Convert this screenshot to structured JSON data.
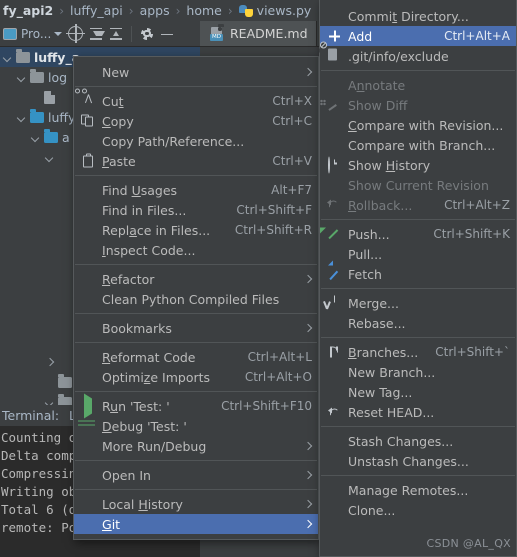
{
  "breadcrumb": {
    "items": [
      {
        "label": "fy_api2",
        "bold": true,
        "icon": ""
      },
      {
        "label": "luffy_api",
        "bold": false,
        "icon": ""
      },
      {
        "label": "apps",
        "bold": false,
        "icon": ""
      },
      {
        "label": "home",
        "bold": false,
        "icon": ""
      },
      {
        "label": "views.py",
        "bold": false,
        "icon": "python-file-icon"
      }
    ],
    "separator": "›"
  },
  "project_toolbar": {
    "project_label": "Pro...",
    "icons": [
      "project-icon",
      "locate-target-icon",
      "expand-all-icon",
      "collapse-all-icon",
      "settings-gear-icon",
      "minimize-icon"
    ]
  },
  "editor_tabs": {
    "tabs": [
      {
        "label": "README.md",
        "icon": "markdown-file-icon",
        "active": true
      }
    ]
  },
  "project_tree": {
    "rows": [
      {
        "indent": 0,
        "chevron": "down",
        "icon": "folder-grey",
        "label": "luffy_a",
        "bold": true,
        "selected": true
      },
      {
        "indent": 1,
        "chevron": "down",
        "icon": "folder-grey",
        "label": "log",
        "bold": false,
        "selected": false
      },
      {
        "indent": 2,
        "chevron": "none",
        "icon": "file",
        "label": "",
        "bold": false,
        "selected": false
      },
      {
        "indent": 1,
        "chevron": "down",
        "icon": "folder-blue",
        "label": "luffy",
        "bold": false,
        "selected": false
      },
      {
        "indent": 2,
        "chevron": "down",
        "icon": "folder-blue",
        "label": "a",
        "bold": false,
        "selected": false
      },
      {
        "indent": 3,
        "chevron": "down",
        "icon": "",
        "label": "",
        "bold": false,
        "selected": false
      }
    ],
    "lower_rows": [
      {
        "indent": 3,
        "chevron": "right",
        "icon": "",
        "label": "",
        "bold": false,
        "selected": false
      },
      {
        "indent": 3,
        "chevron": "none",
        "icon": "folder-grey",
        "label": "",
        "bold": false,
        "selected": false
      },
      {
        "indent": 3,
        "chevron": "down",
        "icon": "folder-grey",
        "label": "",
        "bold": false,
        "selected": false
      }
    ]
  },
  "terminal": {
    "title": "Terminal:",
    "tab_label": "L",
    "lines": [
      "Counting o",
      "Delta comp",
      "Compressin",
      "Writing ob",
      "Total 6 (d",
      "remote: Po"
    ]
  },
  "context_menu": {
    "items": [
      {
        "label": "New",
        "mnemonic": "",
        "shortcut": "",
        "arrow": true,
        "icon": "",
        "disabled": false,
        "highlighted": false
      },
      {
        "separator": true
      },
      {
        "label": "Cut",
        "mnemonic": "t",
        "shortcut": "Ctrl+X",
        "arrow": false,
        "icon": "cut-icon",
        "disabled": false,
        "highlighted": false
      },
      {
        "label": "Copy",
        "mnemonic": "C",
        "shortcut": "Ctrl+C",
        "arrow": false,
        "icon": "copy-icon",
        "disabled": false,
        "highlighted": false
      },
      {
        "label": "Copy Path/Reference...",
        "mnemonic": "",
        "shortcut": "",
        "arrow": false,
        "icon": "",
        "disabled": false,
        "highlighted": false
      },
      {
        "label": "Paste",
        "mnemonic": "P",
        "shortcut": "Ctrl+V",
        "arrow": false,
        "icon": "paste-icon",
        "disabled": false,
        "highlighted": false
      },
      {
        "separator": true
      },
      {
        "label": "Find Usages",
        "mnemonic": "U",
        "shortcut": "Alt+F7",
        "arrow": false,
        "icon": "",
        "disabled": false,
        "highlighted": false
      },
      {
        "label": "Find in Files...",
        "mnemonic": "",
        "shortcut": "Ctrl+Shift+F",
        "arrow": false,
        "icon": "",
        "disabled": false,
        "highlighted": false
      },
      {
        "label": "Replace in Files...",
        "mnemonic": "a",
        "shortcut": "Ctrl+Shift+R",
        "arrow": false,
        "icon": "",
        "disabled": false,
        "highlighted": false
      },
      {
        "label": "Inspect Code...",
        "mnemonic": "I",
        "shortcut": "",
        "arrow": false,
        "icon": "",
        "disabled": false,
        "highlighted": false
      },
      {
        "separator": true
      },
      {
        "label": "Refactor",
        "mnemonic": "R",
        "shortcut": "",
        "arrow": true,
        "icon": "",
        "disabled": false,
        "highlighted": false
      },
      {
        "label": "Clean Python Compiled Files",
        "mnemonic": "",
        "shortcut": "",
        "arrow": false,
        "icon": "",
        "disabled": false,
        "highlighted": false
      },
      {
        "separator": true
      },
      {
        "label": "Bookmarks",
        "mnemonic": "",
        "shortcut": "",
        "arrow": true,
        "icon": "",
        "disabled": false,
        "highlighted": false
      },
      {
        "separator": true
      },
      {
        "label": "Reformat Code",
        "mnemonic": "R",
        "shortcut": "Ctrl+Alt+L",
        "arrow": false,
        "icon": "",
        "disabled": false,
        "highlighted": false
      },
      {
        "label": "Optimize Imports",
        "mnemonic": "z",
        "shortcut": "Ctrl+Alt+O",
        "arrow": false,
        "icon": "",
        "disabled": false,
        "highlighted": false
      },
      {
        "separator": true
      },
      {
        "label": "Run 'Test: '",
        "mnemonic": "u",
        "shortcut": "Ctrl+Shift+F10",
        "arrow": false,
        "icon": "run-icon",
        "disabled": false,
        "highlighted": false
      },
      {
        "label": "Debug 'Test: '",
        "mnemonic": "D",
        "shortcut": "",
        "arrow": false,
        "icon": "debug-icon",
        "disabled": false,
        "highlighted": false
      },
      {
        "label": "More Run/Debug",
        "mnemonic": "",
        "shortcut": "",
        "arrow": true,
        "icon": "",
        "disabled": false,
        "highlighted": false
      },
      {
        "separator": true
      },
      {
        "label": "Open In",
        "mnemonic": "",
        "shortcut": "",
        "arrow": true,
        "icon": "",
        "disabled": false,
        "highlighted": false
      },
      {
        "separator": true
      },
      {
        "label": "Local History",
        "mnemonic": "H",
        "shortcut": "",
        "arrow": true,
        "icon": "",
        "disabled": false,
        "highlighted": false
      },
      {
        "label": "Git",
        "mnemonic": "G",
        "shortcut": "",
        "arrow": true,
        "icon": "",
        "disabled": false,
        "highlighted": true
      }
    ]
  },
  "git_submenu": {
    "items": [
      {
        "label": "Commit Directory...",
        "mnemonic": "t",
        "shortcut": "",
        "arrow": false,
        "icon": "",
        "disabled": false,
        "highlighted": false
      },
      {
        "label": "Add",
        "mnemonic": "",
        "shortcut": "Ctrl+Alt+A",
        "arrow": false,
        "icon": "plus-icon",
        "disabled": false,
        "highlighted": true
      },
      {
        "label": ".git/info/exclude",
        "mnemonic": "",
        "shortcut": "",
        "arrow": false,
        "icon": "git-exclude-icon",
        "disabled": false,
        "highlighted": false
      },
      {
        "separator": true
      },
      {
        "label": "Annotate",
        "mnemonic": "n",
        "shortcut": "",
        "arrow": false,
        "icon": "",
        "disabled": true,
        "highlighted": false
      },
      {
        "label": "Show Diff",
        "mnemonic": "",
        "shortcut": "",
        "arrow": false,
        "icon": "show-diff-icon",
        "disabled": true,
        "highlighted": false
      },
      {
        "label": "Compare with Revision...",
        "mnemonic": "C",
        "shortcut": "",
        "arrow": false,
        "icon": "",
        "disabled": false,
        "highlighted": false
      },
      {
        "label": "Compare with Branch...",
        "mnemonic": "",
        "shortcut": "",
        "arrow": false,
        "icon": "",
        "disabled": false,
        "highlighted": false
      },
      {
        "label": "Show History",
        "mnemonic": "H",
        "shortcut": "",
        "arrow": false,
        "icon": "clock-icon",
        "disabled": false,
        "highlighted": false
      },
      {
        "label": "Show Current Revision",
        "mnemonic": "",
        "shortcut": "",
        "arrow": false,
        "icon": "",
        "disabled": true,
        "highlighted": false
      },
      {
        "label": "Rollback...",
        "mnemonic": "R",
        "shortcut": "Ctrl+Alt+Z",
        "arrow": false,
        "icon": "rollback-icon",
        "disabled": true,
        "highlighted": false
      },
      {
        "separator": true
      },
      {
        "label": "Push...",
        "mnemonic": "",
        "shortcut": "Ctrl+Shift+K",
        "arrow": false,
        "icon": "push-icon",
        "disabled": false,
        "highlighted": false
      },
      {
        "label": "Pull...",
        "mnemonic": "",
        "shortcut": "",
        "arrow": false,
        "icon": "",
        "disabled": false,
        "highlighted": false
      },
      {
        "label": "Fetch",
        "mnemonic": "",
        "shortcut": "",
        "arrow": false,
        "icon": "fetch-icon",
        "disabled": false,
        "highlighted": false
      },
      {
        "separator": true
      },
      {
        "label": "Merge...",
        "mnemonic": "",
        "shortcut": "",
        "arrow": false,
        "icon": "merge-icon",
        "disabled": false,
        "highlighted": false
      },
      {
        "label": "Rebase...",
        "mnemonic": "",
        "shortcut": "",
        "arrow": false,
        "icon": "",
        "disabled": false,
        "highlighted": false
      },
      {
        "separator": true
      },
      {
        "label": "Branches...",
        "mnemonic": "B",
        "shortcut": "Ctrl+Shift+`",
        "arrow": false,
        "icon": "branch-icon",
        "disabled": false,
        "highlighted": false
      },
      {
        "label": "New Branch...",
        "mnemonic": "",
        "shortcut": "",
        "arrow": false,
        "icon": "",
        "disabled": false,
        "highlighted": false
      },
      {
        "label": "New Tag...",
        "mnemonic": "",
        "shortcut": "",
        "arrow": false,
        "icon": "",
        "disabled": false,
        "highlighted": false
      },
      {
        "label": "Reset HEAD...",
        "mnemonic": "",
        "shortcut": "",
        "arrow": false,
        "icon": "reset-head-icon",
        "disabled": false,
        "highlighted": false
      },
      {
        "separator": true
      },
      {
        "label": "Stash Changes...",
        "mnemonic": "",
        "shortcut": "",
        "arrow": false,
        "icon": "",
        "disabled": false,
        "highlighted": false
      },
      {
        "label": "Unstash Changes...",
        "mnemonic": "",
        "shortcut": "",
        "arrow": false,
        "icon": "",
        "disabled": false,
        "highlighted": false
      },
      {
        "separator": true
      },
      {
        "label": "Manage Remotes...",
        "mnemonic": "",
        "shortcut": "",
        "arrow": false,
        "icon": "",
        "disabled": false,
        "highlighted": false
      },
      {
        "label": "Clone...",
        "mnemonic": "",
        "shortcut": "",
        "arrow": false,
        "icon": "",
        "disabled": false,
        "highlighted": false
      }
    ]
  },
  "watermark": {
    "text": "CSDN @AL_QX"
  },
  "colors": {
    "background": "#3c3f41",
    "menu_bg": "#3c3f41",
    "menu_border": "#565a5c",
    "highlight": "#4b6eaf",
    "tree_selected": "#2f4661",
    "text": "#bbbbbb",
    "text_dim": "#777b7e",
    "terminal_bg": "#2b2b2b",
    "accent_green": "#59a869",
    "accent_blue": "#4a90d9",
    "folder_blue": "#3592c4"
  }
}
